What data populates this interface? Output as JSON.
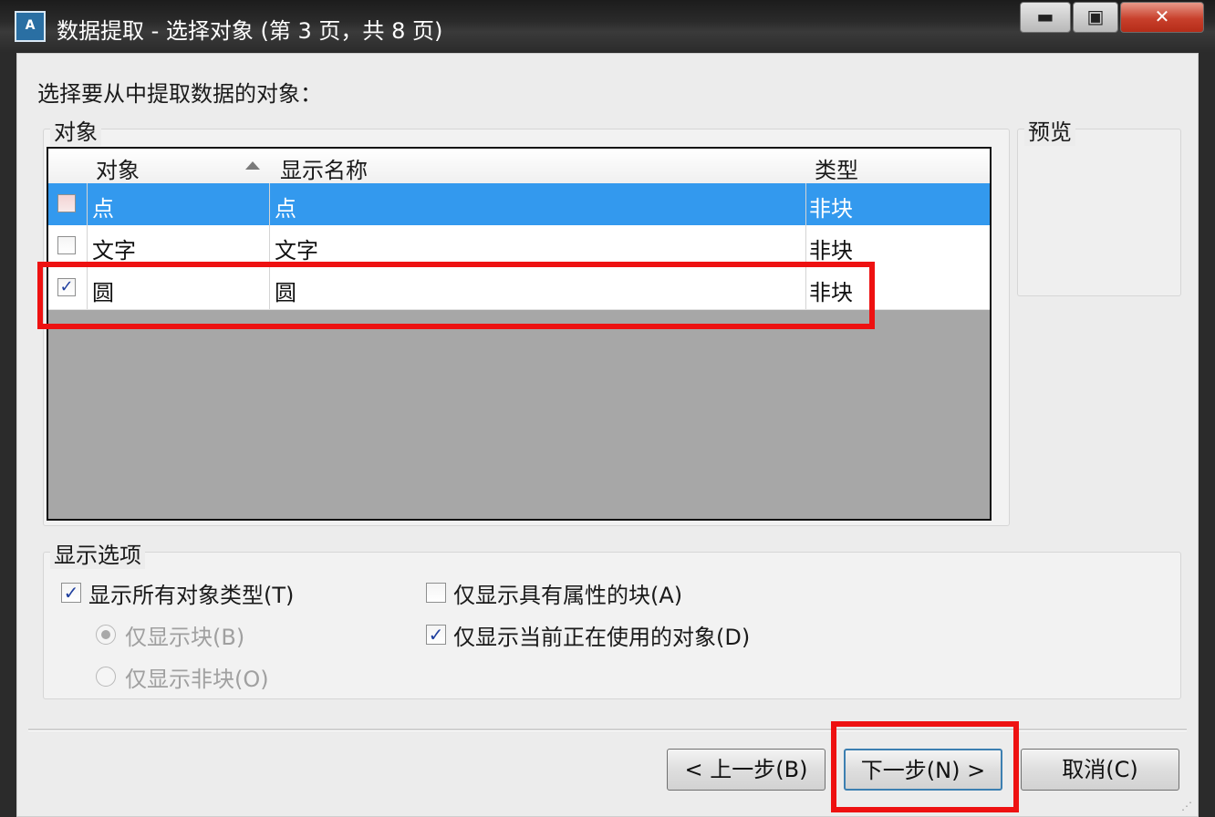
{
  "window": {
    "title": "数据提取 - 选择对象 (第 3 页，共 8 页)",
    "app_icon": "autocad-icon",
    "min_glyph": "▬",
    "max_glyph": "▣",
    "close_glyph": "✕"
  },
  "instruction": "选择要从中提取数据的对象：",
  "objects_group": {
    "title": "对象",
    "columns": [
      "对象",
      "显示名称",
      "类型"
    ],
    "rows": [
      {
        "checked": false,
        "object": "点",
        "display_name": "点",
        "type": "非块",
        "selected": true
      },
      {
        "checked": false,
        "object": "文字",
        "display_name": "文字",
        "type": "非块",
        "selected": false
      },
      {
        "checked": true,
        "object": "圆",
        "display_name": "圆",
        "type": "非块",
        "selected": false
      }
    ]
  },
  "preview_group": {
    "title": "预览"
  },
  "display_options": {
    "title": "显示选项",
    "show_all_types": {
      "label": "显示所有对象类型(T)",
      "checked": true
    },
    "only_blocks": {
      "label": "仅显示块(B)",
      "selected": true,
      "enabled": false
    },
    "only_non_blocks": {
      "label": "仅显示非块(O)",
      "selected": false,
      "enabled": false
    },
    "only_blocks_with_attrs": {
      "label": "仅显示具有属性的块(A)",
      "checked": false
    },
    "only_in_use": {
      "label": "仅显示当前正在使用的对象(D)",
      "checked": true
    }
  },
  "buttons": {
    "back": "< 上一步(B)",
    "next": "下一步(N) >",
    "cancel": "取消(C)"
  },
  "colors": {
    "selection": "#3399ee",
    "highlight_box": "#ee1111"
  }
}
